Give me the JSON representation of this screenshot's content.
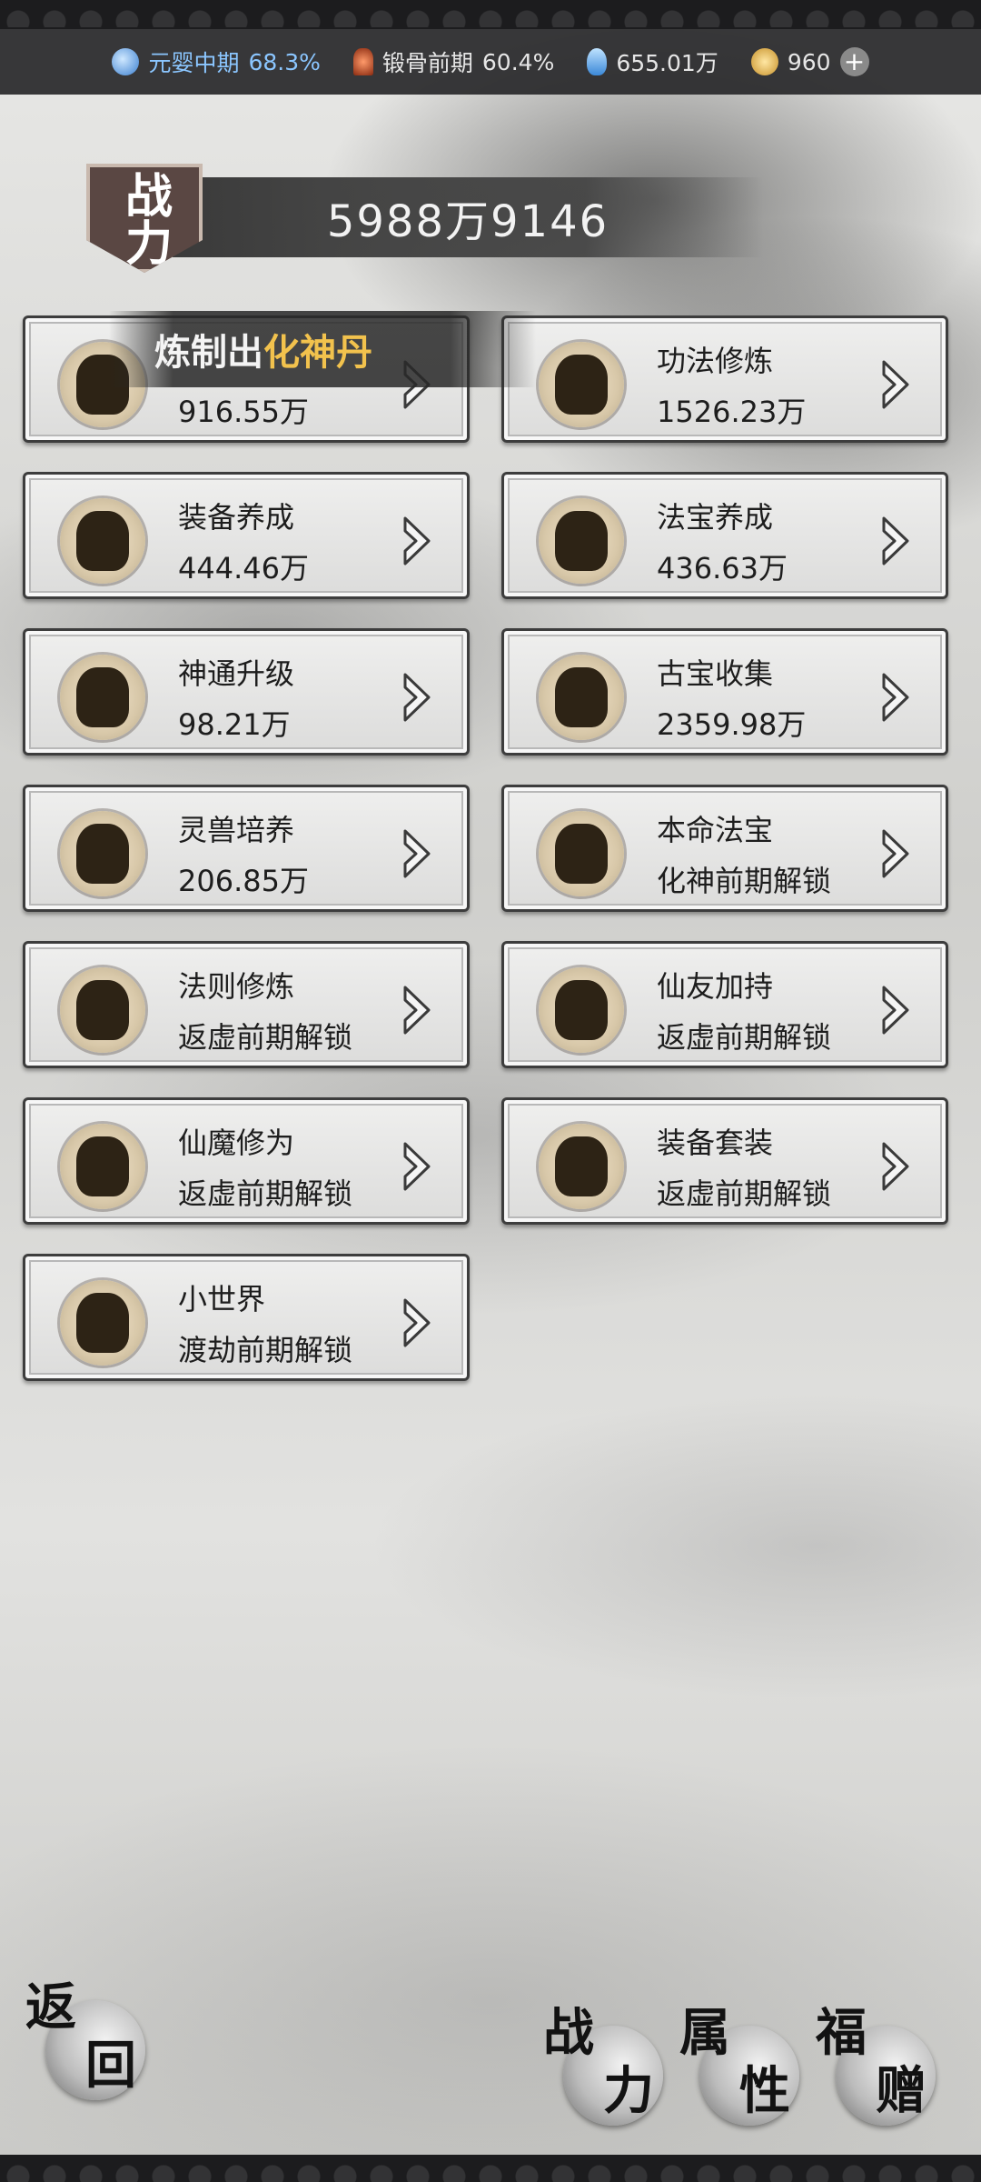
{
  "status": {
    "realm_label": "元婴中期",
    "realm_pct": "68.3%",
    "body_label": "锻骨前期",
    "body_pct": "60.4%",
    "spirit_stone": "655.01万",
    "currency": "960",
    "add_symbol": "+"
  },
  "power": {
    "badge": "战力",
    "value": "5988万9146"
  },
  "toast": {
    "prefix": "炼制出",
    "item": "化神丹"
  },
  "cards": [
    {
      "name": "",
      "value": "916.55万"
    },
    {
      "name": "功法修炼",
      "value": "1526.23万"
    },
    {
      "name": "装备养成",
      "value": "444.46万"
    },
    {
      "name": "法宝养成",
      "value": "436.63万"
    },
    {
      "name": "神通升级",
      "value": "98.21万"
    },
    {
      "name": "古宝收集",
      "value": "2359.98万"
    },
    {
      "name": "灵兽培养",
      "value": "206.85万"
    },
    {
      "name": "本命法宝",
      "value": "化神前期解锁"
    },
    {
      "name": "法则修炼",
      "value": "返虚前期解锁"
    },
    {
      "name": "仙友加持",
      "value": "返虚前期解锁"
    },
    {
      "name": "仙魔修为",
      "value": "返虚前期解锁"
    },
    {
      "name": "装备套装",
      "value": "返虚前期解锁"
    },
    {
      "name": "小世界",
      "value": "渡劫前期解锁"
    }
  ],
  "bottom_nav": {
    "back": [
      "返",
      "回"
    ],
    "power": [
      "战",
      "力"
    ],
    "attr": [
      "属",
      "性"
    ],
    "gift": [
      "福",
      "赠"
    ]
  },
  "colors": {
    "toast_highlight": "#f2c24d",
    "realm_blue": "#8bc6ff"
  }
}
